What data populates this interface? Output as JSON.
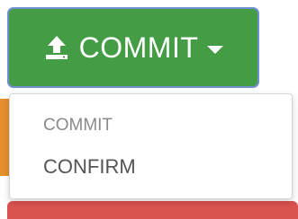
{
  "button": {
    "label": "COMMIT",
    "icon": "upload-icon",
    "caret": "chevron-down-icon",
    "color": "#449d44"
  },
  "dropdown": {
    "header": "COMMIT",
    "items": [
      {
        "label": "CONFIRM"
      }
    ]
  },
  "colors": {
    "orange_edge": "#e58f2e",
    "red_edge": "#d9534f"
  }
}
